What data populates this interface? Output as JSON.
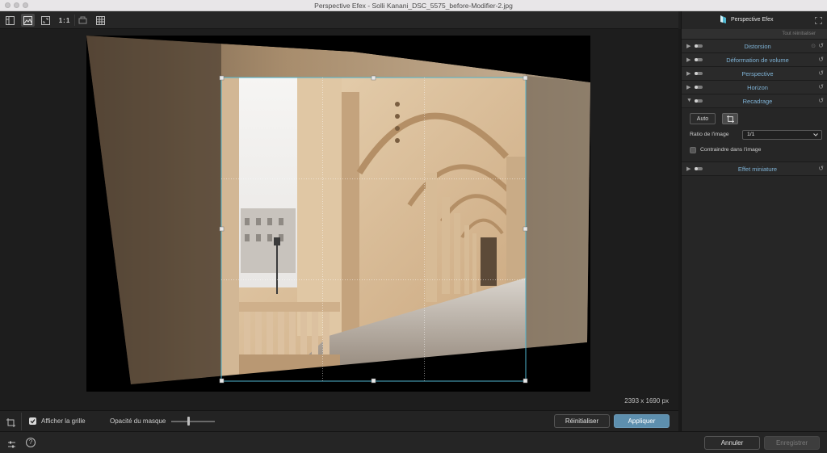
{
  "window": {
    "title": "Perspective Efex - Solli Kanani_DSC_5575_before-Modifier-2.jpg"
  },
  "toolbar": {
    "actual_size_label": "1:1"
  },
  "canvas": {
    "dimensions": "2393 x 1690 px"
  },
  "bottom_tools": {
    "show_grid_label": "Afficher la grille",
    "show_grid_checked": true,
    "mask_opacity_label": "Opacité du masque",
    "mask_opacity_value": 0.4,
    "reset_label": "Réinitialiser",
    "apply_label": "Appliquer"
  },
  "panel": {
    "title": "Perspective Efex",
    "reset_all": "Tout réinitialiser",
    "sections": [
      {
        "label": "Distorsion",
        "expanded": false
      },
      {
        "label": "Déformation de volume",
        "expanded": false
      },
      {
        "label": "Perspective",
        "expanded": false
      },
      {
        "label": "Horizon",
        "expanded": false
      },
      {
        "label": "Recadrage",
        "expanded": true
      },
      {
        "label": "Effet miniature",
        "expanded": false
      }
    ],
    "recadrage": {
      "auto_label": "Auto",
      "ratio_label": "Ratio de l'image",
      "ratio_value": "1/1",
      "constrain_label": "Contraindre dans l'image"
    }
  },
  "statusbar": {
    "cancel_label": "Annuler",
    "save_label": "Enregistrer"
  },
  "colors": {
    "accent": "#5d8fae",
    "section_label": "#7fb3d6",
    "crop_border": "#4fb6d0"
  }
}
